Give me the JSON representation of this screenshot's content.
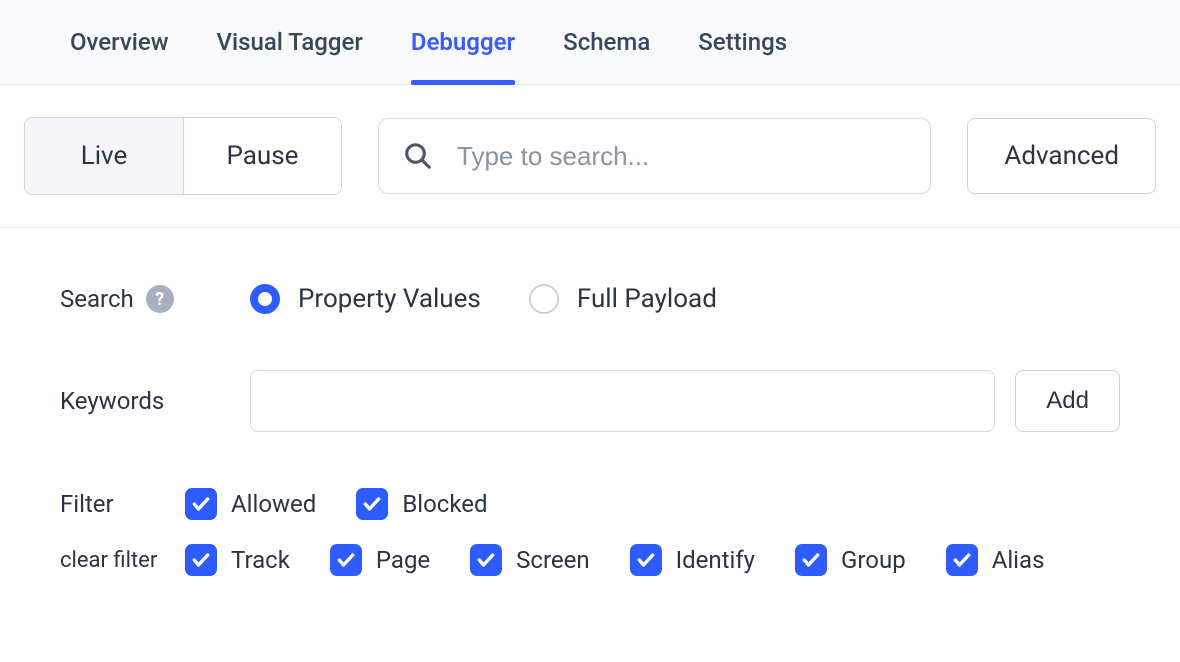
{
  "nav": {
    "items": [
      {
        "label": "Overview",
        "active": false
      },
      {
        "label": "Visual Tagger",
        "active": false
      },
      {
        "label": "Debugger",
        "active": true
      },
      {
        "label": "Schema",
        "active": false
      },
      {
        "label": "Settings",
        "active": false
      }
    ]
  },
  "toolbar": {
    "segment": {
      "live": "Live",
      "pause": "Pause",
      "selected": "Live"
    },
    "search_placeholder": "Type to search...",
    "advanced_label": "Advanced"
  },
  "search_section": {
    "label": "Search",
    "options": {
      "property_values": "Property Values",
      "full_payload": "Full Payload"
    },
    "selected": "property_values"
  },
  "keywords": {
    "label": "Keywords",
    "value": "",
    "add_label": "Add"
  },
  "filters": {
    "label": "Filter",
    "clear_label": "clear filter",
    "status": [
      {
        "key": "allowed",
        "label": "Allowed",
        "checked": true
      },
      {
        "key": "blocked",
        "label": "Blocked",
        "checked": true
      }
    ],
    "types": [
      {
        "key": "track",
        "label": "Track",
        "checked": true
      },
      {
        "key": "page",
        "label": "Page",
        "checked": true
      },
      {
        "key": "screen",
        "label": "Screen",
        "checked": true
      },
      {
        "key": "identify",
        "label": "Identify",
        "checked": true
      },
      {
        "key": "group",
        "label": "Group",
        "checked": true
      },
      {
        "key": "alias",
        "label": "Alias",
        "checked": true
      }
    ]
  }
}
